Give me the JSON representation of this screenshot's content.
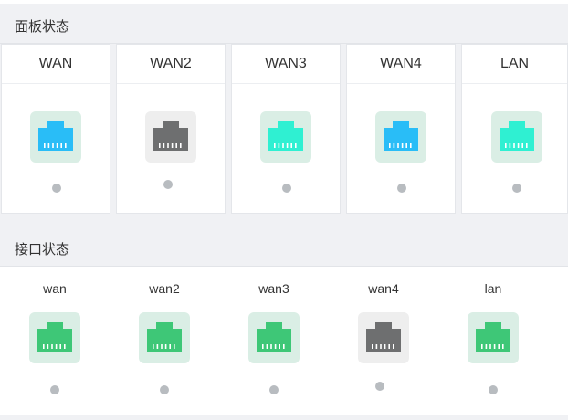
{
  "panel_status": {
    "title": "面板状态",
    "ports": [
      {
        "label": "WAN",
        "icon": "ethernet-port-icon",
        "icon_color": "#29bdf7",
        "bg_color": "#daeee5"
      },
      {
        "label": "WAN2",
        "icon": "ethernet-port-icon",
        "icon_color": "#6e6f70",
        "bg_color": "#eeeeee"
      },
      {
        "label": "WAN3",
        "icon": "ethernet-port-icon",
        "icon_color": "#2ff0d2",
        "bg_color": "#daeee5"
      },
      {
        "label": "WAN4",
        "icon": "ethernet-port-icon",
        "icon_color": "#29bdf7",
        "bg_color": "#daeee5"
      },
      {
        "label": "LAN",
        "icon": "ethernet-port-icon",
        "icon_color": "#2ff0d2",
        "bg_color": "#daeee5"
      }
    ]
  },
  "interface_status": {
    "title": "接口状态",
    "interfaces": [
      {
        "label": "wan",
        "icon": "ethernet-port-icon",
        "icon_color": "#3ec777",
        "bg_color": "#daeee5"
      },
      {
        "label": "wan2",
        "icon": "ethernet-port-icon",
        "icon_color": "#3ec777",
        "bg_color": "#daeee5"
      },
      {
        "label": "wan3",
        "icon": "ethernet-port-icon",
        "icon_color": "#3ec777",
        "bg_color": "#daeee5"
      },
      {
        "label": "wan4",
        "icon": "ethernet-port-icon",
        "icon_color": "#6e6f70",
        "bg_color": "#eeeeee"
      },
      {
        "label": "lan",
        "icon": "ethernet-port-icon",
        "icon_color": "#3ec777",
        "bg_color": "#daeee5"
      }
    ]
  },
  "colors": {
    "status_dot": "#b8bcc0",
    "header_bg": "#f0f1f4"
  }
}
